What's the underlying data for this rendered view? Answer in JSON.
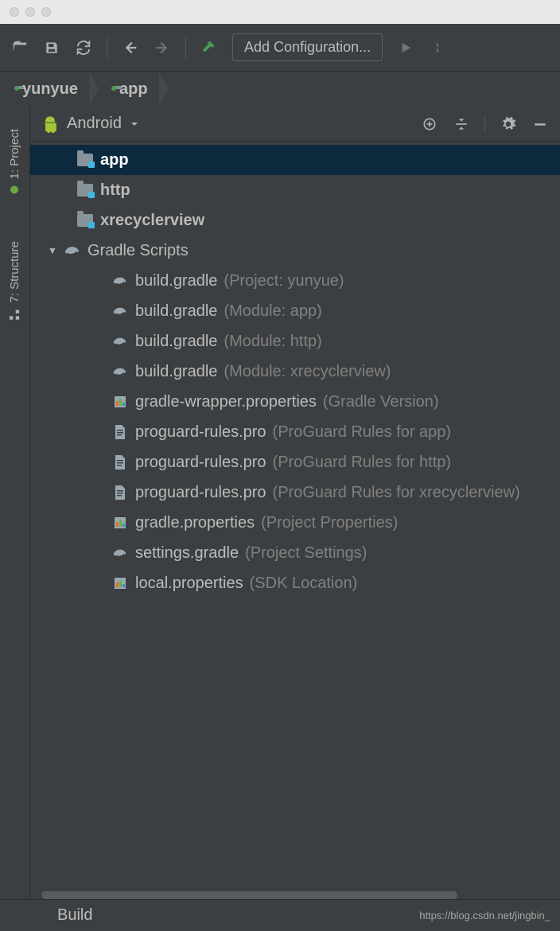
{
  "toolbar": {
    "config_label": "Add Configuration..."
  },
  "breadcrumb": {
    "root": "yunyue",
    "module": "app"
  },
  "side_tabs": {
    "project": "1: Project",
    "structure": "7: Structure"
  },
  "panel": {
    "view": "Android"
  },
  "tree": {
    "modules": [
      {
        "name": "app",
        "selected": true
      },
      {
        "name": "http",
        "selected": false
      },
      {
        "name": "xrecyclerview",
        "selected": false
      }
    ],
    "gradle_section": "Gradle Scripts",
    "gradle_files": [
      {
        "name": "build.gradle",
        "meta": "(Project: yunyue)",
        "icon": "gradle"
      },
      {
        "name": "build.gradle",
        "meta": "(Module: app)",
        "icon": "gradle"
      },
      {
        "name": "build.gradle",
        "meta": "(Module: http)",
        "icon": "gradle"
      },
      {
        "name": "build.gradle",
        "meta": "(Module: xrecyclerview)",
        "icon": "gradle"
      },
      {
        "name": "gradle-wrapper.properties",
        "meta": "(Gradle Version)",
        "icon": "props"
      },
      {
        "name": "proguard-rules.pro",
        "meta": "(ProGuard Rules for app)",
        "icon": "file"
      },
      {
        "name": "proguard-rules.pro",
        "meta": "(ProGuard Rules for http)",
        "icon": "file"
      },
      {
        "name": "proguard-rules.pro",
        "meta": "(ProGuard Rules for xrecyclerview)",
        "icon": "file"
      },
      {
        "name": "gradle.properties",
        "meta": "(Project Properties)",
        "icon": "props"
      },
      {
        "name": "settings.gradle",
        "meta": "(Project Settings)",
        "icon": "gradle"
      },
      {
        "name": "local.properties",
        "meta": "(SDK Location)",
        "icon": "props"
      }
    ]
  },
  "bottom": {
    "build": "Build"
  },
  "watermark": "https://blog.csdn.net/jingbin_"
}
